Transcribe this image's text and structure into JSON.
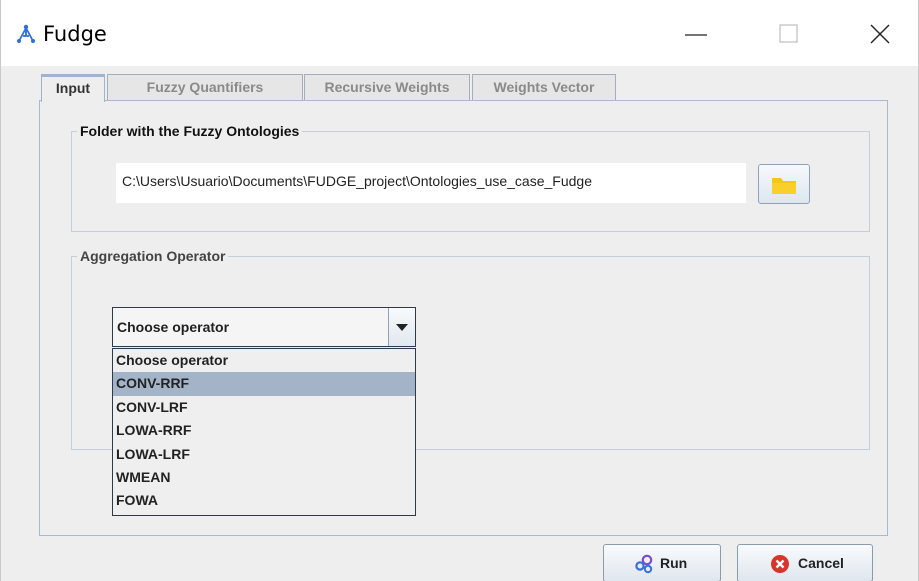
{
  "window": {
    "title": "Fudge",
    "icon": "fudge-logo-icon",
    "controls": [
      "minimize-icon",
      "maximize-icon",
      "close-icon"
    ]
  },
  "tabs": [
    {
      "label": "Input",
      "active": true
    },
    {
      "label": "Fuzzy Quantifiers",
      "active": false
    },
    {
      "label": "Recursive Weights",
      "active": false
    },
    {
      "label": "Weights Vector",
      "active": false
    }
  ],
  "folder_group": {
    "title": "Folder with the Fuzzy Ontologies",
    "path": "C:\\Users\\Usuario\\Documents\\FUDGE_project\\Ontologies_use_case_Fudge",
    "browse_icon": "folder-icon"
  },
  "aggregation_group": {
    "title": "Aggregation Operator",
    "selected": "Choose operator",
    "options": [
      "Choose operator",
      "CONV-RRF",
      "CONV-LRF",
      "LOWA-RRF",
      "LOWA-LRF",
      "WMEAN",
      "FOWA"
    ],
    "highlighted_option": "CONV-RRF"
  },
  "buttons": {
    "run_label": "Run",
    "run_icon": "gears-icon",
    "cancel_label": "Cancel",
    "cancel_icon": "cancel-icon"
  },
  "colors": {
    "accent": "#9fb4cd",
    "highlight": "#a3b4c8",
    "cancel_red": "#d9342b",
    "folder_yellow": "#f5c518",
    "gear_blue": "#3b6fd8",
    "gear_purple": "#7a4bd1"
  }
}
